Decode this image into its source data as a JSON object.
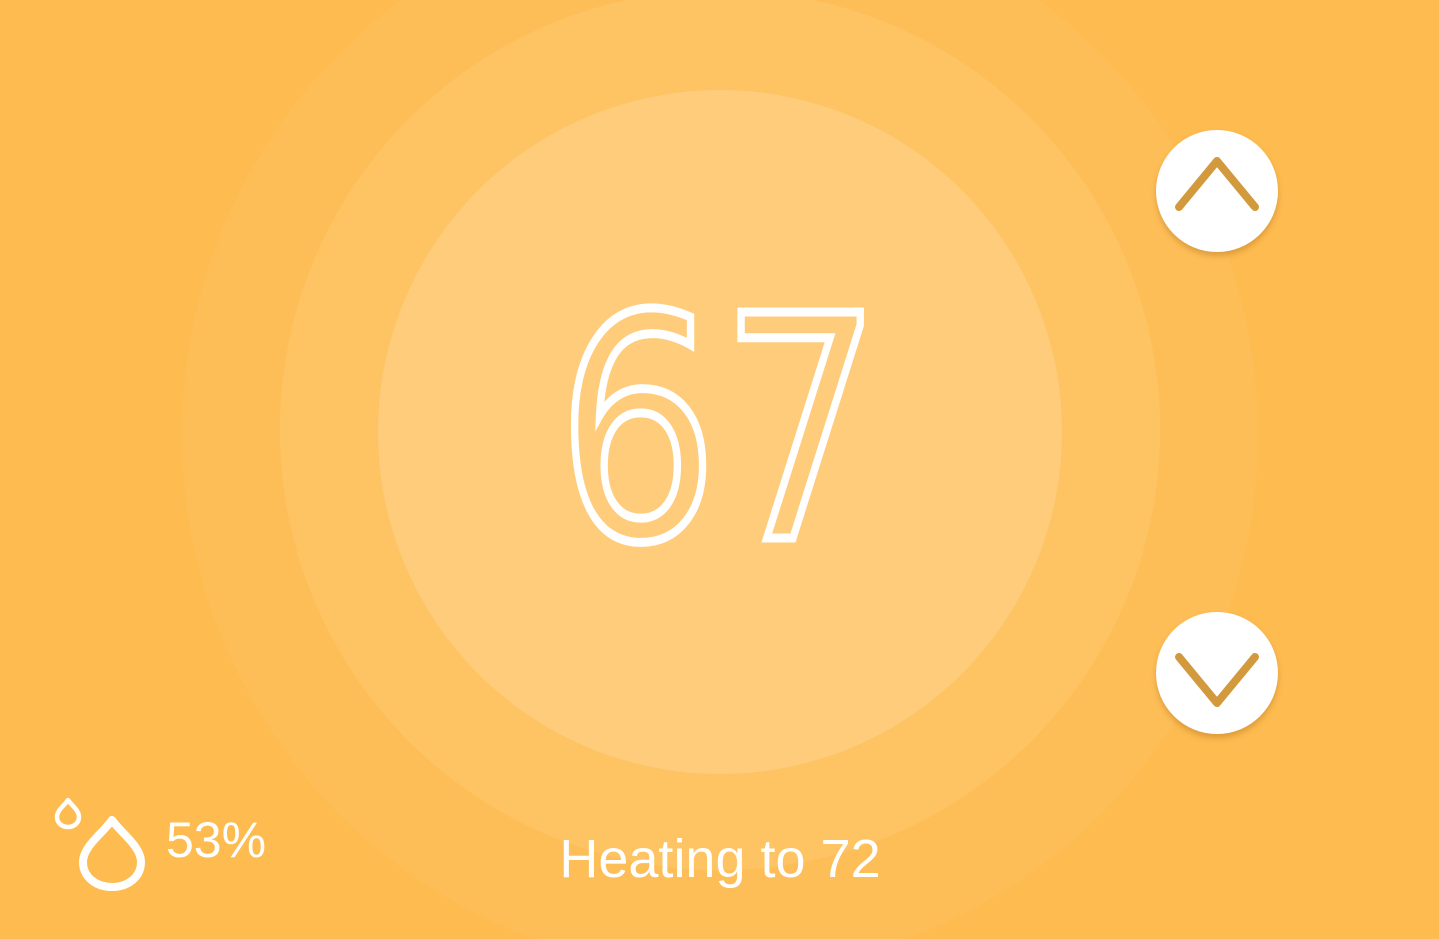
{
  "thermostat": {
    "current_temperature": "67",
    "target_temperature": 72,
    "status_text": "Heating to 72"
  },
  "humidity": {
    "value": "53%",
    "icon": "humidity-drops-icon"
  },
  "controls": {
    "increase_icon": "chevron-up-icon",
    "decrease_icon": "chevron-down-icon"
  },
  "colors": {
    "background": "#FEBB50",
    "ring_outer": "#FEBE57",
    "ring_mid": "#FEC463",
    "ring_inner": "#FECC7A",
    "chevron": "#D29A3C",
    "text": "#FFFFFF"
  }
}
